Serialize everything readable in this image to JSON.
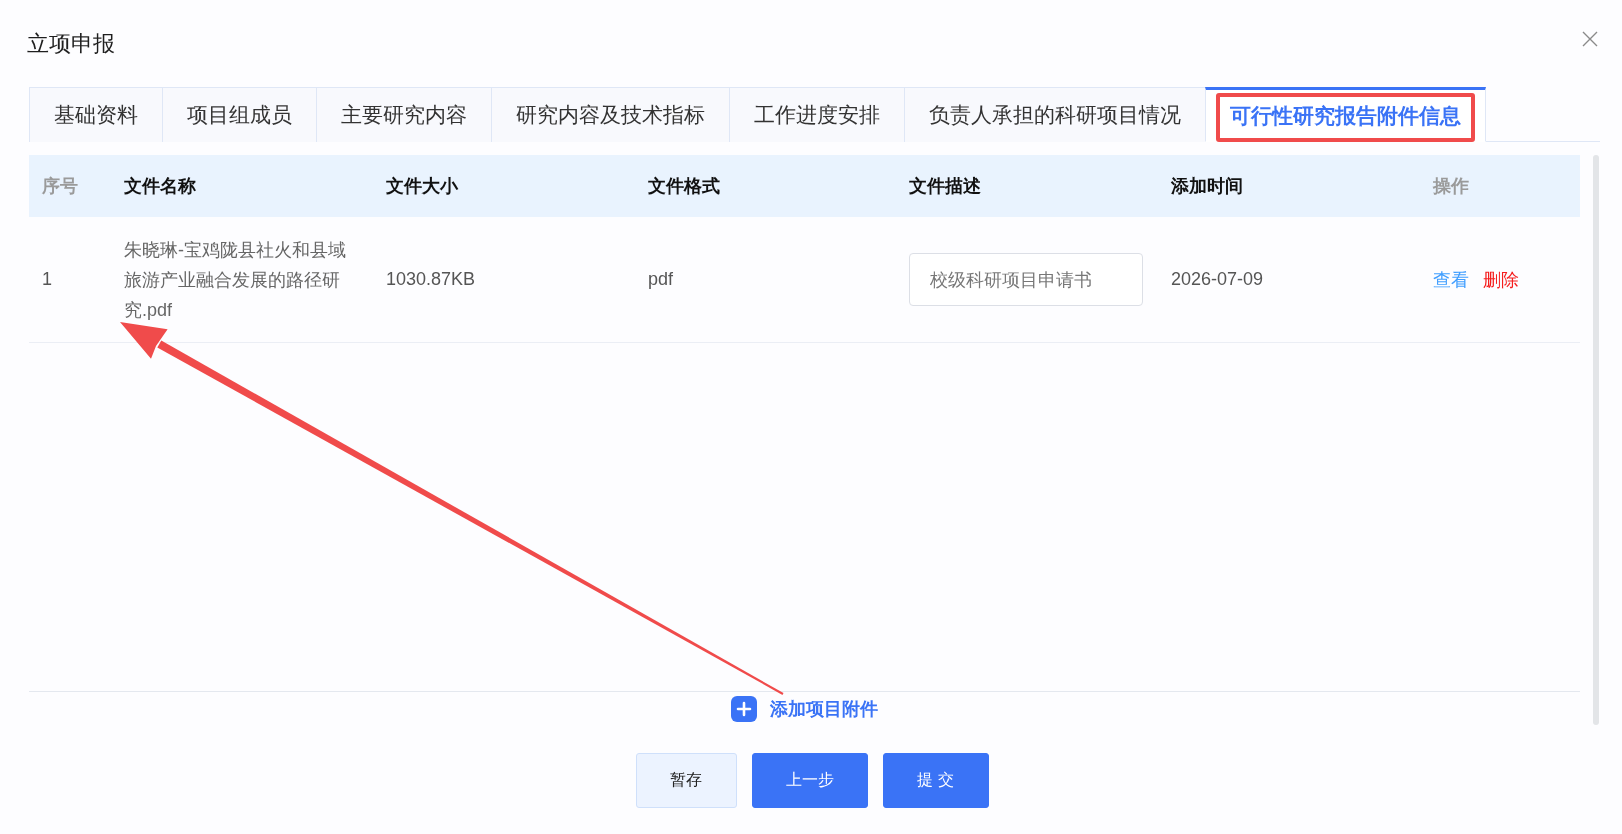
{
  "dialog": {
    "title": "立项申报"
  },
  "tabs": [
    {
      "label": "基础资料",
      "selected": false,
      "highlighted": false
    },
    {
      "label": "项目组成员",
      "selected": false,
      "highlighted": false
    },
    {
      "label": "主要研究内容",
      "selected": false,
      "highlighted": false
    },
    {
      "label": "研究内容及技术指标",
      "selected": false,
      "highlighted": false
    },
    {
      "label": "工作进度安排",
      "selected": false,
      "highlighted": false
    },
    {
      "label": "负责人承担的科研项目情况",
      "selected": false,
      "highlighted": false
    },
    {
      "label": "可行性研究报告附件信息",
      "selected": true,
      "highlighted": true
    }
  ],
  "table": {
    "columns": [
      {
        "label": "序号",
        "dimmed": true
      },
      {
        "label": "文件名称",
        "dimmed": false
      },
      {
        "label": "文件大小",
        "dimmed": false
      },
      {
        "label": "文件格式",
        "dimmed": false
      },
      {
        "label": "文件描述",
        "dimmed": false
      },
      {
        "label": "添加时间",
        "dimmed": false
      },
      {
        "label": "操作",
        "dimmed": true
      }
    ],
    "rows": [
      {
        "index": "1",
        "file_name": "朱晓琳-宝鸡陇县社火和县域旅游产业融合发展的路径研究.pdf",
        "file_size": "1030.87KB",
        "file_format": "pdf",
        "description": "校级科研项目申请书",
        "added_on": "2026-07-09",
        "actions": [
          {
            "label": "查看",
            "kind": "view"
          },
          {
            "label": "删除",
            "kind": "delete"
          }
        ]
      }
    ]
  },
  "add_attachment": {
    "label": "添加项目附件"
  },
  "buttons": [
    {
      "label": "暂存",
      "kind": "secondary"
    },
    {
      "label": "上一步",
      "kind": "primary"
    },
    {
      "label": "提 交",
      "kind": "primary"
    }
  ],
  "annotations": [
    {
      "kind": "arrow"
    }
  ]
}
